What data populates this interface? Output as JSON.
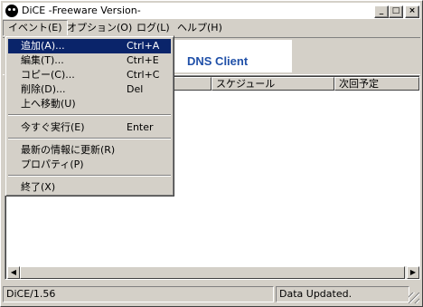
{
  "window": {
    "title": "DiCE -Freeware Version-"
  },
  "title_buttons": {
    "minimize": "_",
    "maximize": "□",
    "close": "×"
  },
  "menubar": [
    "イベント(E)",
    "オプション(O)",
    "ログ(L)",
    "ヘルプ(H)"
  ],
  "banner": {
    "text": "DNS Client"
  },
  "list": {
    "columns": [
      "",
      "スケジュール",
      "次回予定"
    ]
  },
  "scroll": {
    "left": "◀",
    "right": "▶"
  },
  "status": {
    "left": "DiCE/1.56",
    "right": "Data Updated."
  },
  "event_menu": {
    "items": [
      {
        "label": "追加(A)...",
        "shortcut": "Ctrl+A",
        "selected": true
      },
      {
        "label": "編集(T)...",
        "shortcut": "Ctrl+E"
      },
      {
        "label": "コピー(C)...",
        "shortcut": "Ctrl+C"
      },
      {
        "label": "削除(D)...",
        "shortcut": "Del"
      },
      {
        "label": "上へ移動(U)",
        "shortcut": ""
      },
      {
        "label": "今すぐ実行(E)",
        "shortcut": "Enter"
      },
      {
        "label": "最新の情報に更新(R)",
        "shortcut": ""
      },
      {
        "label": "プロパティ(P)",
        "shortcut": ""
      },
      {
        "label": "終了(X)",
        "shortcut": ""
      }
    ]
  }
}
